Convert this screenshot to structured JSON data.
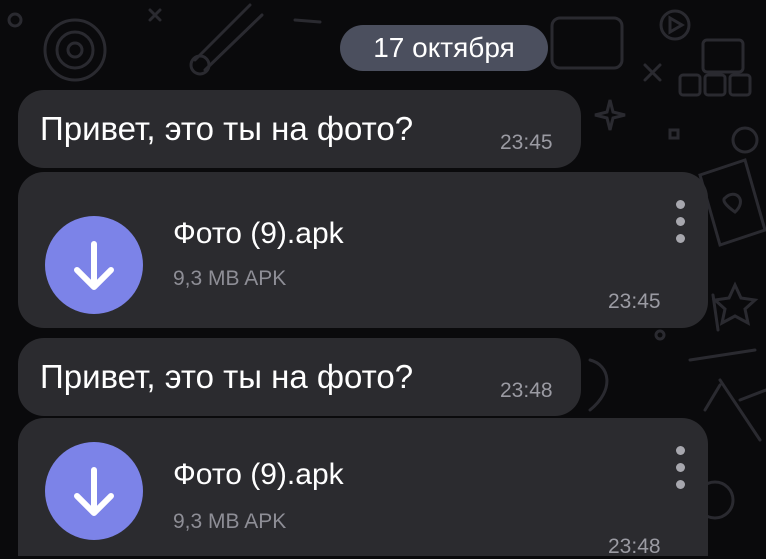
{
  "date_separator": "17 октября",
  "messages": [
    {
      "type": "text",
      "text": "Привет, это ты на фото?",
      "time": "23:45"
    },
    {
      "type": "file",
      "file_name": "Фото (9).apk",
      "file_meta": "9,3 MB APK",
      "time": "23:45",
      "icon": "download-arrow-icon"
    },
    {
      "type": "text",
      "text": "Привет, это ты на фото?",
      "time": "23:48"
    },
    {
      "type": "file",
      "file_name": "Фото (9).apk",
      "file_meta": "9,3 MB APK",
      "time": "23:48",
      "icon": "download-arrow-icon"
    }
  ],
  "colors": {
    "background": "#0a0a0c",
    "bubble": "#2b2b2f",
    "date_pill": "#4b4f5e",
    "file_icon": "#7c83e8",
    "time_text": "#9b9ba3"
  }
}
